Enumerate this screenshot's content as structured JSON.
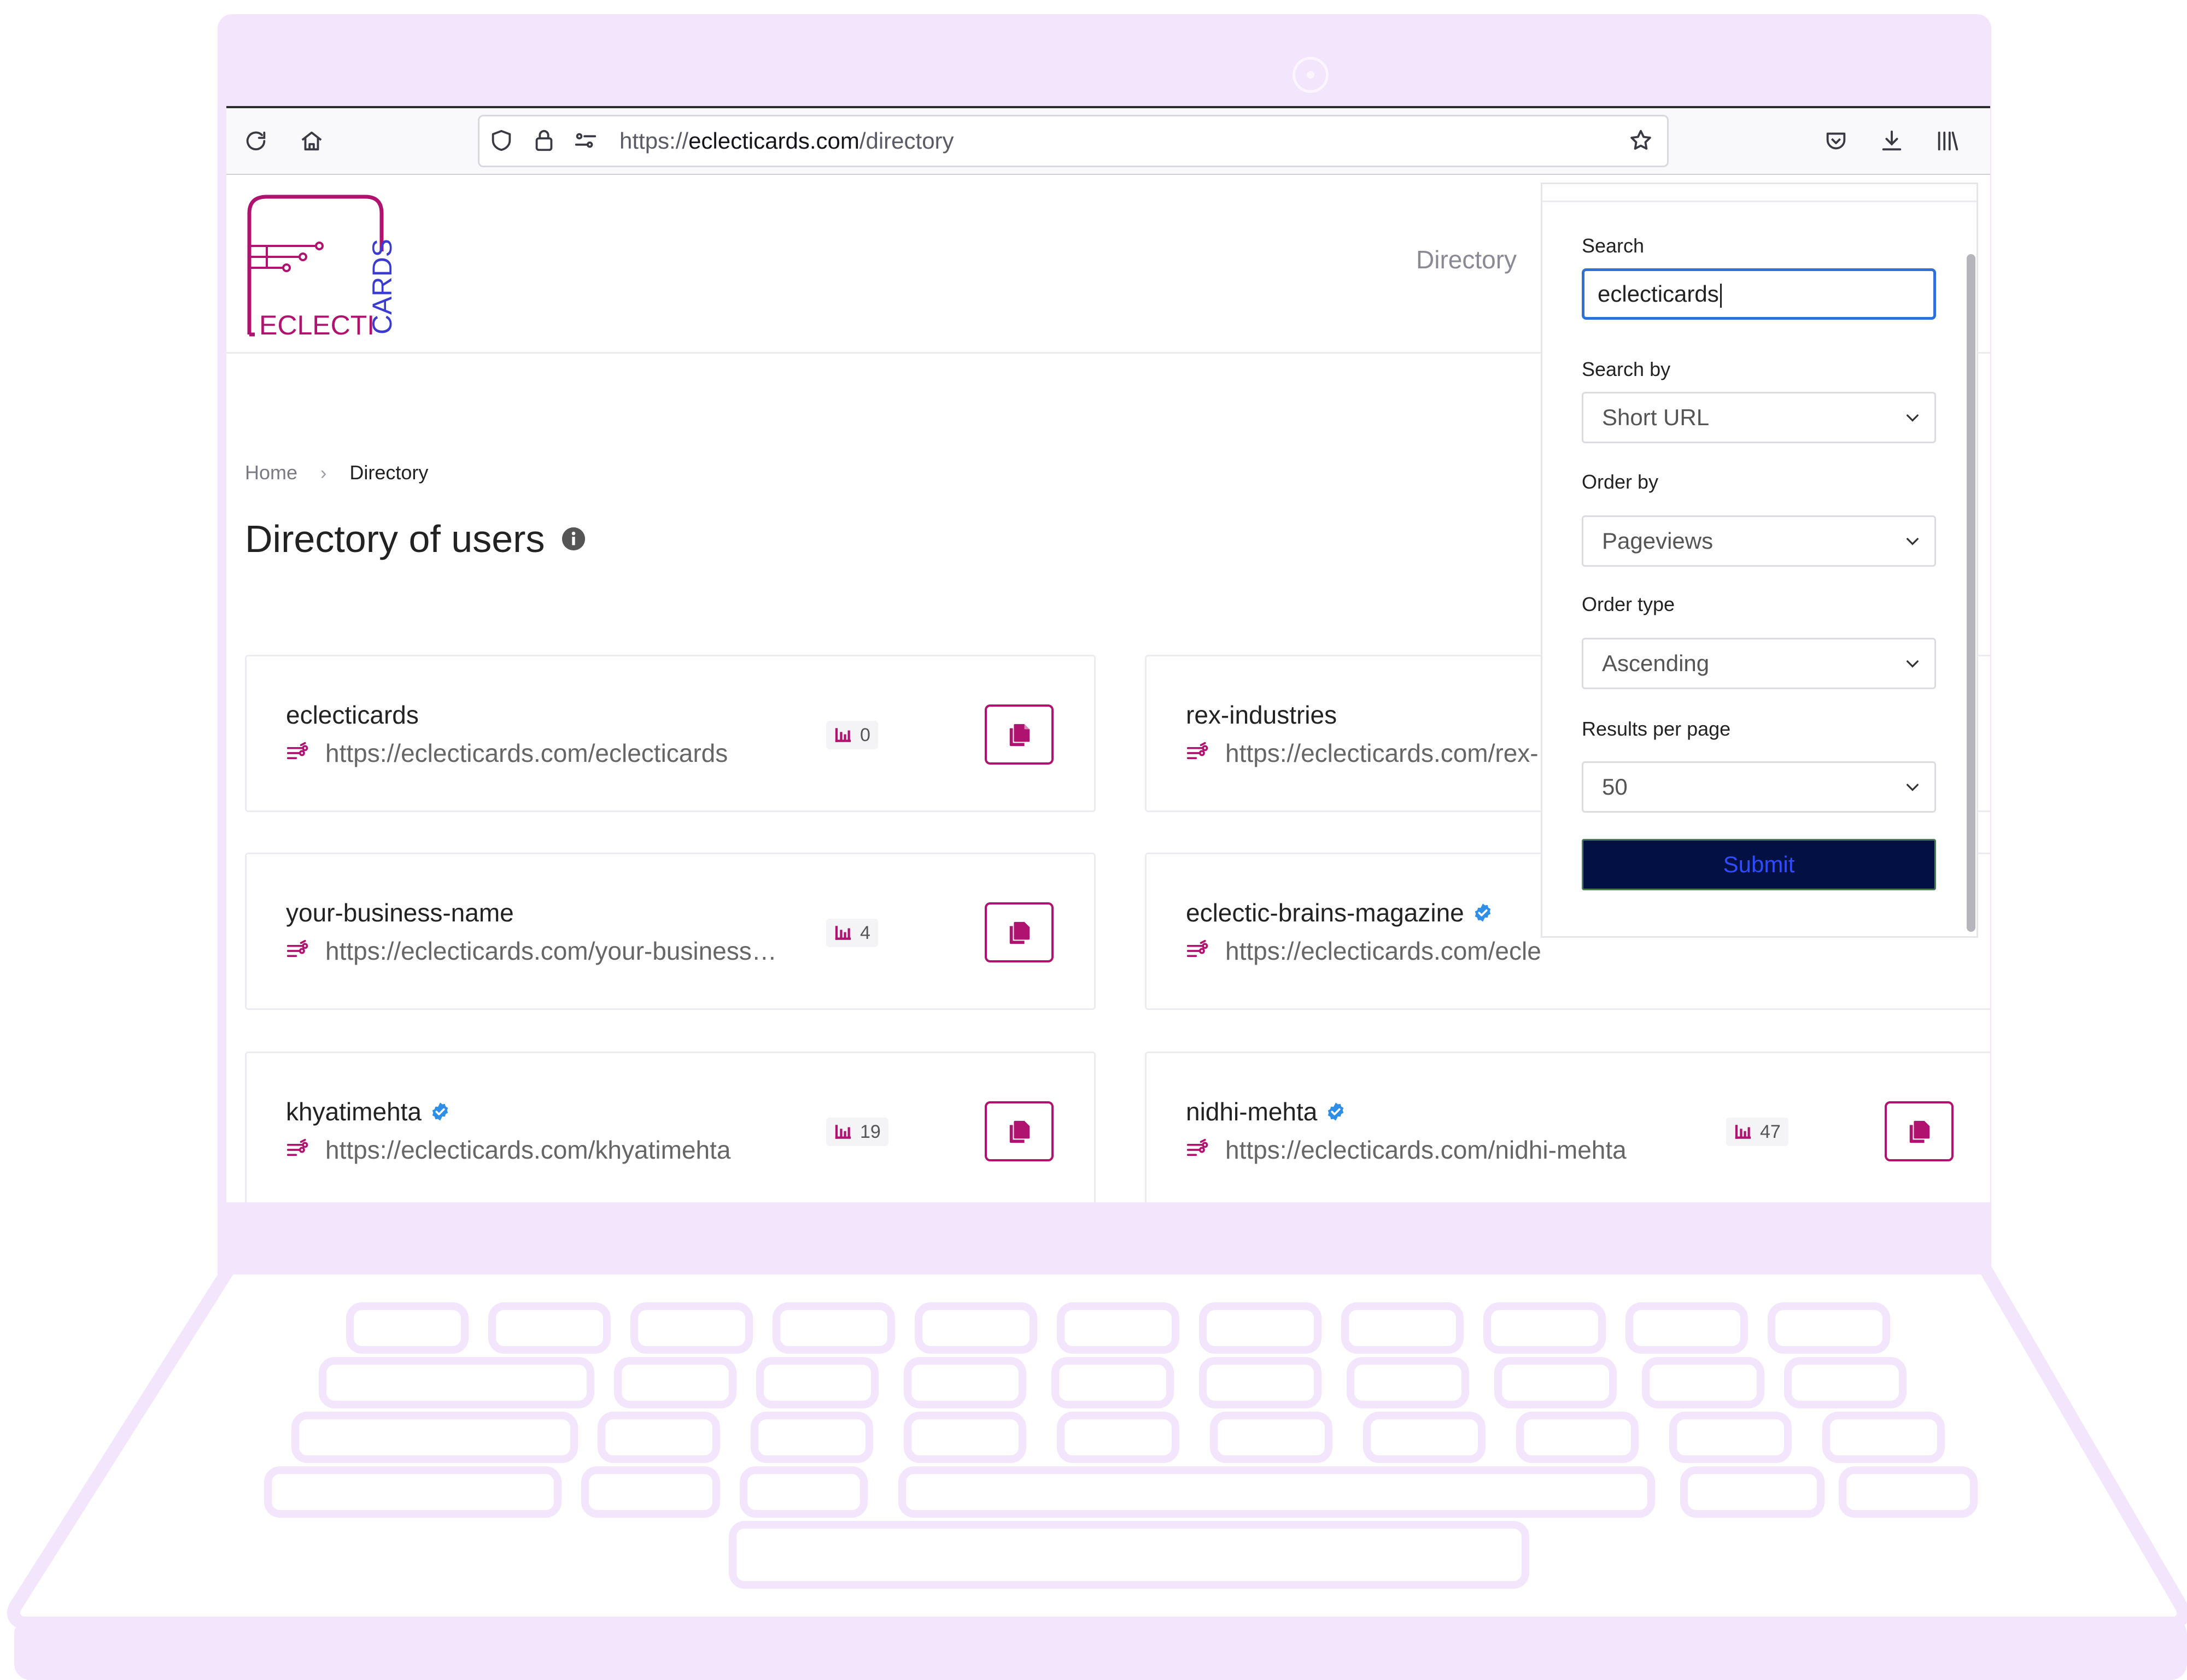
{
  "browser": {
    "url_scheme": "https://",
    "url_host": "eclecticards.com",
    "url_path": "/directory"
  },
  "header": {
    "logo_text_left": "ECLECTI",
    "logo_text_vertical": "CARDS",
    "nav_directory": "Directory"
  },
  "breadcrumb": {
    "home": "Home",
    "current": "Directory"
  },
  "page": {
    "title": "Directory of users"
  },
  "cards": [
    {
      "name": "eclecticards",
      "url": "https://eclecticards.com/eclecticards",
      "views": "0",
      "verified": false
    },
    {
      "name": "rex-industries",
      "url": "https://eclecticards.com/rex-",
      "views": "",
      "verified": false
    },
    {
      "name": "your-business-name",
      "url": "https://eclecticards.com/your-business…",
      "views": "4",
      "verified": false
    },
    {
      "name": "eclectic-brains-magazine",
      "url": "https://eclecticards.com/ecle",
      "views": "",
      "verified": true
    },
    {
      "name": "khyatimehta",
      "url": "https://eclecticards.com/khyatimehta",
      "views": "19",
      "verified": true
    },
    {
      "name": "nidhi-mehta",
      "url": "https://eclecticards.com/nidhi-mehta",
      "views": "47",
      "verified": true
    }
  ],
  "search_panel": {
    "search_label": "Search",
    "search_value": "eclecticards",
    "search_by_label": "Search by",
    "search_by_value": "Short URL",
    "order_by_label": "Order by",
    "order_by_value": "Pageviews",
    "order_type_label": "Order type",
    "order_type_value": "Ascending",
    "results_label": "Results per page",
    "results_value": "50",
    "submit_label": "Submit"
  },
  "colors": {
    "brand": "#b0126f",
    "brand_blue": "#3b3bd1",
    "verified": "#2f8fe8",
    "frame": "#f3e5fc",
    "submit_bg": "#021043"
  }
}
